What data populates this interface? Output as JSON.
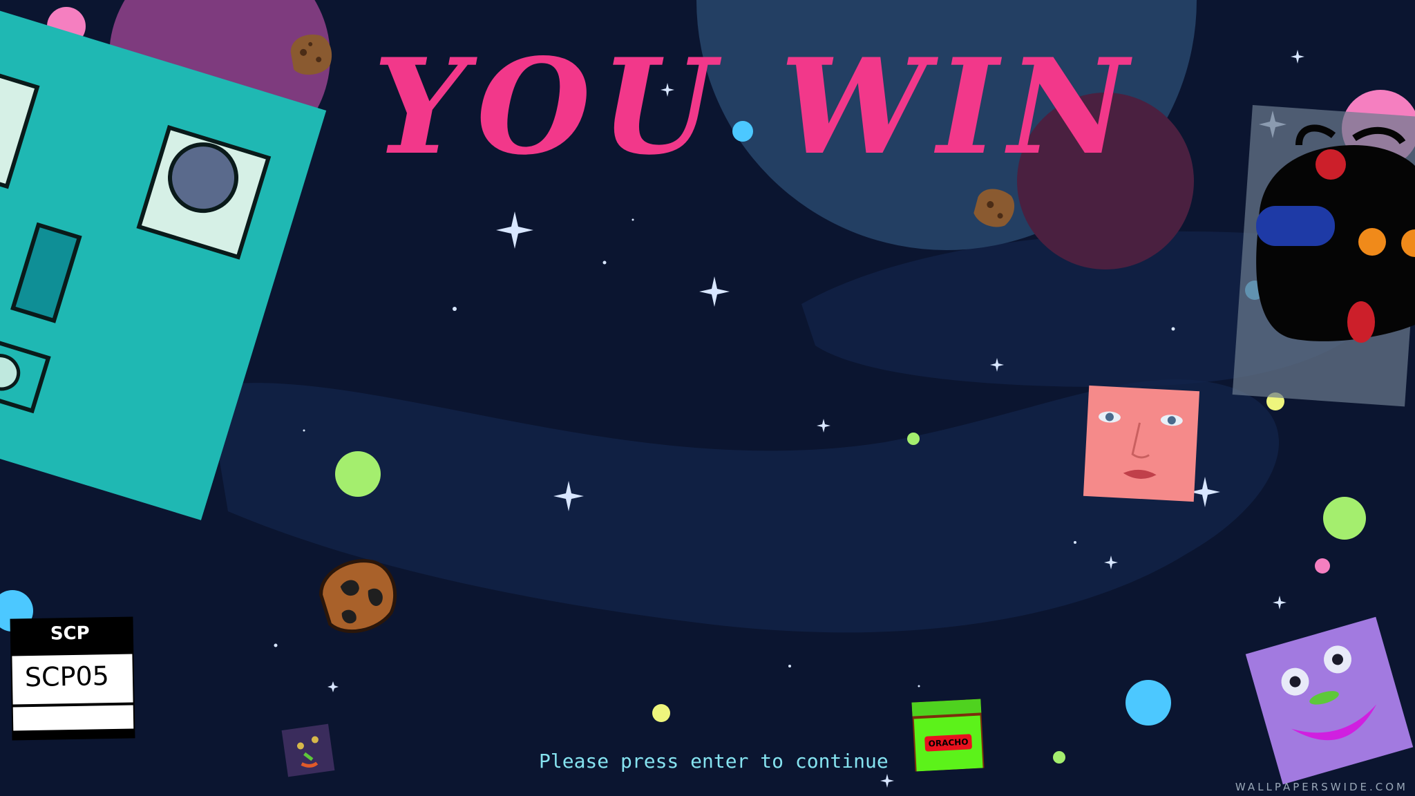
{
  "screen": {
    "title": "YOU WIN",
    "prompt": "Please press enter to continue",
    "watermark": "WALLPAPERSWIDE.COM"
  },
  "sprites": {
    "scp_card": {
      "logo_text": "SCP",
      "name": "SCP05"
    },
    "chip_bag": {
      "label": "ORACHO"
    }
  },
  "colors": {
    "background": "#0b1530",
    "title": "#f2388a",
    "prompt": "#86e3f0",
    "teal_cube": "#1fb8b3",
    "planet_purple": "#7e3b7e",
    "planet_blue": "#233f63",
    "planet_maroon": "#4a2040"
  }
}
